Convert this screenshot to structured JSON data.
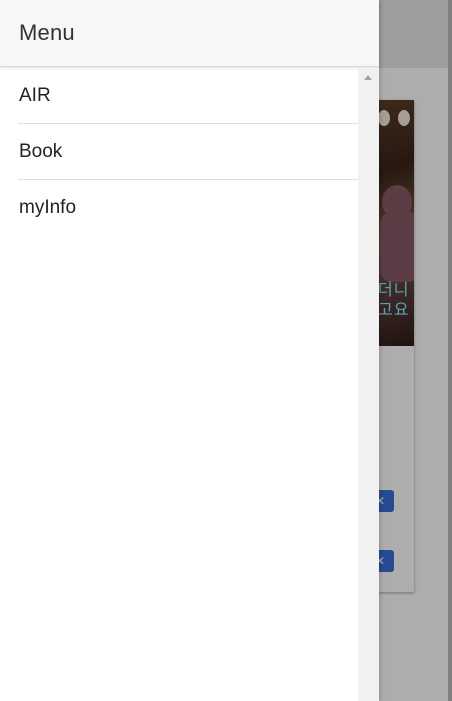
{
  "drawer": {
    "title": "Menu",
    "items": [
      {
        "label": "AIR"
      },
      {
        "label": "Book"
      },
      {
        "label": "myInfo"
      }
    ]
  },
  "background": {
    "sign_text": "더니\n고요"
  },
  "icons": {
    "scroll_up": "triangle-up",
    "card_buttons": "close-icon"
  },
  "colors": {
    "drawer_header_bg": "#f7f7f7",
    "overlay": "rgba(0,0,0,0.32)",
    "button_blue": "#3a6fd8"
  }
}
